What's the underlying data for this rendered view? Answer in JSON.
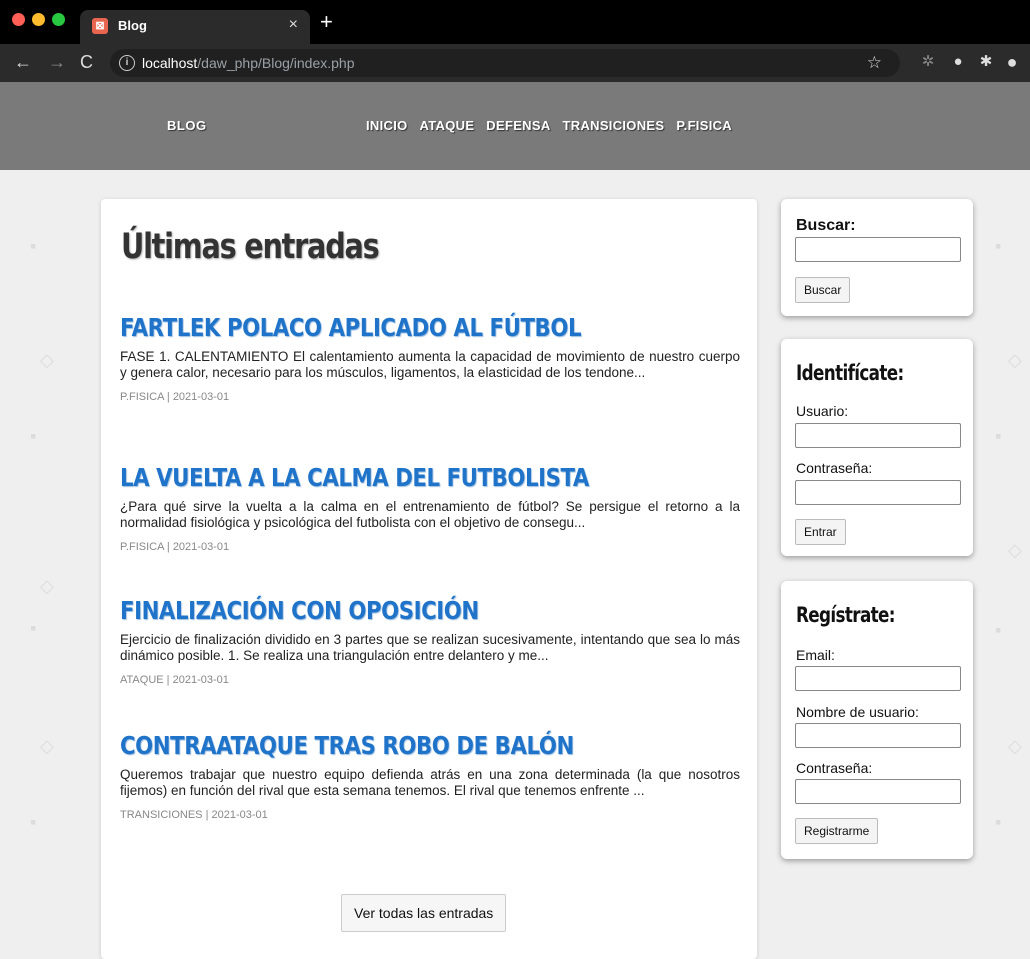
{
  "browser": {
    "tab_title": "Blog",
    "tab_favicon": "⊠",
    "url_host": "localhost",
    "url_path": "/daw_php/Blog/index.php"
  },
  "icons": {
    "back": "←",
    "forward": "→",
    "reload": "C",
    "info": "i",
    "star": "☆",
    "close": "×",
    "new_tab": "+",
    "ext_gear": "✲",
    "ext_circle": "●",
    "ext_puzzle": "✱",
    "profile": "●"
  },
  "header": {
    "brand": "BLOG",
    "nav": [
      "INICIO",
      "ATAQUE",
      "DEFENSA",
      "TRANSICIONES",
      "P.FISICA"
    ]
  },
  "main": {
    "title": "Últimas entradas",
    "entries": [
      {
        "title": "FARTLEK POLACO APLICADO AL FÚTBOL",
        "excerpt": "FASE 1. CALENTAMIENTO El calentamiento aumenta la capacidad de movimiento de nuestro cuerpo y genera calor, necesario para los músculos, ligamentos, la elasticidad de los tendone...",
        "category": "P.FISICA",
        "date": "2021-03-01"
      },
      {
        "title": "LA VUELTA A LA CALMA DEL FUTBOLISTA",
        "excerpt": "¿Para qué sirve la vuelta a la calma en el entrenamiento de fútbol? Se persigue el retorno a la normalidad fisiológica y psicológica del futbolista con el objetivo de consegu...",
        "category": "P.FISICA",
        "date": "2021-03-01"
      },
      {
        "title": "FINALIZACIÓN CON OPOSICIÓN",
        "excerpt": "Ejercicio de finalización dividido en 3 partes que se realizan sucesivamente, intentando que sea lo más dinámico posible. 1. Se realiza una triangulación entre delantero y me...",
        "category": "ATAQUE",
        "date": "2021-03-01"
      },
      {
        "title": "CONTRAATAQUE TRAS ROBO DE BALÓN",
        "excerpt": "Queremos trabajar que nuestro equipo defienda atrás en una zona determinada (la que nosotros fijemos) en función del rival que esta semana tenemos. El rival que tenemos enfrente ...",
        "category": "TRANSICIONES",
        "date": "2021-03-01"
      }
    ],
    "meta_separator": " | ",
    "view_all_label": "Ver todas las entradas"
  },
  "sidebar": {
    "search": {
      "title": "Buscar:",
      "value": "",
      "button": "Buscar"
    },
    "login": {
      "title": "Identifícate:",
      "user_label": "Usuario:",
      "password_label": "Contraseña:",
      "button": "Entrar"
    },
    "register": {
      "title": "Regístrate:",
      "email_label": "Email:",
      "username_label": "Nombre de usuario:",
      "password_label": "Contraseña:",
      "button": "Registrarme"
    }
  }
}
